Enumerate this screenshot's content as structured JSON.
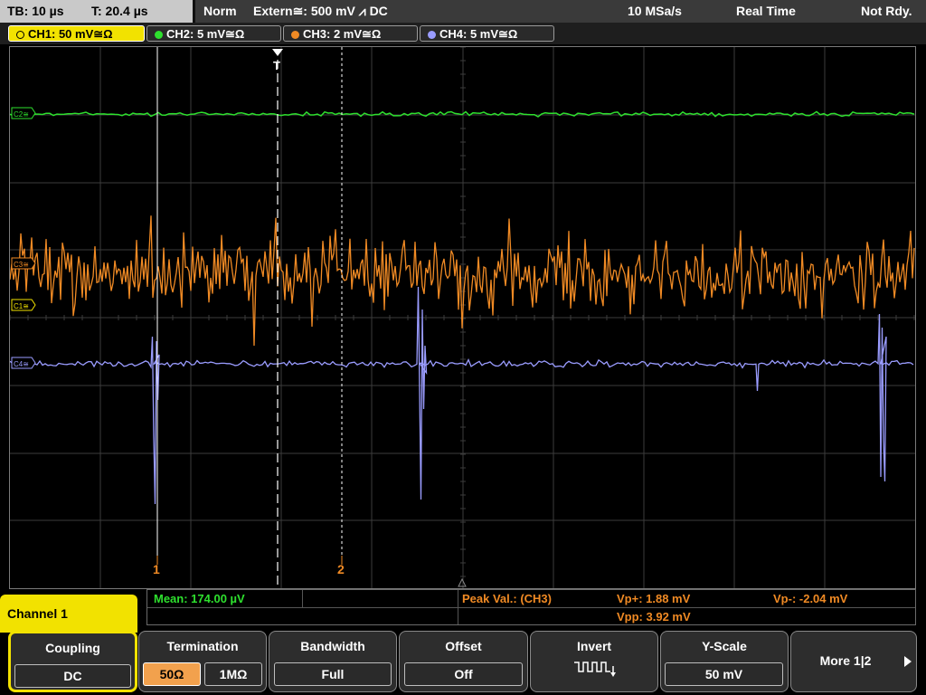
{
  "status": {
    "timebase": "TB: 10 µs",
    "trigger_time": "T: 20.4 µs",
    "mode": "Norm",
    "trigger_source": "Extern≅: 500 mV ⩘ DC",
    "sample_rate": "10 MSa/s",
    "acq_mode": "Real Time",
    "state": "Not Rdy."
  },
  "channel_tabs": [
    {
      "label": "CH1: 50 mV≅Ω",
      "color": "#f2e200",
      "active": true
    },
    {
      "label": "CH2: 5 mV≅Ω",
      "color": "#2ee02e",
      "active": false
    },
    {
      "label": "CH3: 2 mV≅Ω",
      "color": "#f08a24",
      "active": false
    },
    {
      "label": "CH4: 5 mV≅Ω",
      "color": "#9a9cff",
      "active": false
    }
  ],
  "trace_markers": {
    "ch2": "C2≅",
    "ch3": "C3≅",
    "ch1": "C1≅",
    "ch4": "C4≅",
    "trigger": "T",
    "cursor1": "1",
    "cursor2": "2"
  },
  "colors": {
    "ch1": "#f2e200",
    "ch2": "#2ee02e",
    "ch3": "#f08a24",
    "ch4": "#9a9cff",
    "grid": "#3c3c3c",
    "meas_green": "#2ee02e",
    "meas_orange": "#f08a24"
  },
  "measurements": {
    "mean": "Mean: 174.00 µV",
    "peak_label": "Peak Val.:  (CH3)",
    "vp_plus": "Vp+: 1.88 mV",
    "vp_minus": "Vp-: -2.04 mV",
    "vpp": "Vpp: 3.92 mV"
  },
  "menu": {
    "channel_label": "Channel 1",
    "coupling": {
      "title": "Coupling",
      "value": "DC"
    },
    "termination": {
      "title": "Termination",
      "options": [
        "50Ω",
        "1MΩ"
      ],
      "selected": "50Ω"
    },
    "bandwidth": {
      "title": "Bandwidth",
      "value": "Full"
    },
    "offset": {
      "title": "Offset",
      "value": "Off"
    },
    "invert": {
      "title": "Invert"
    },
    "yscale": {
      "title": "Y-Scale",
      "value": "50 mV"
    },
    "more": {
      "label": "More 1|2"
    }
  }
}
